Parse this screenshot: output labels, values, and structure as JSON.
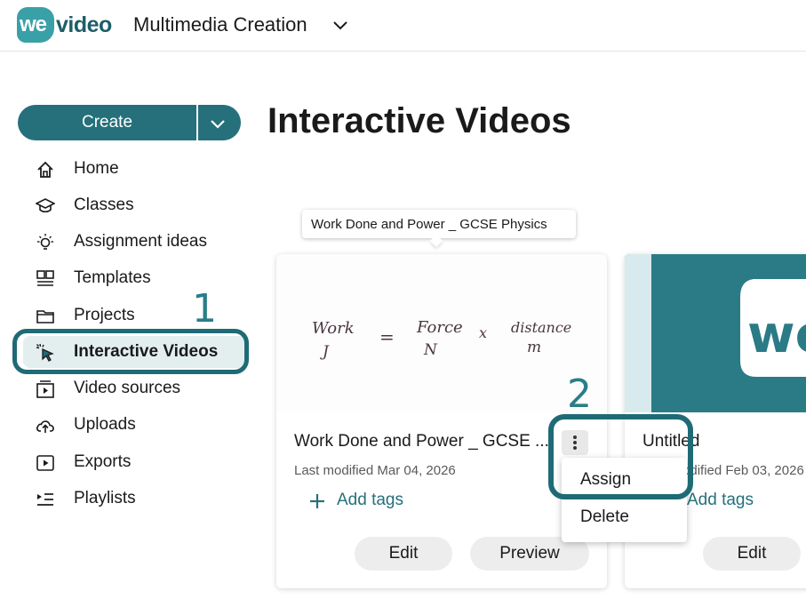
{
  "header": {
    "logo_we": "we",
    "logo_video": "video",
    "workspace_name": "Multimedia Creation"
  },
  "sidebar": {
    "create_label": "Create",
    "items": [
      {
        "label": "Home",
        "icon": "home-icon"
      },
      {
        "label": "Classes",
        "icon": "graduation-cap-icon"
      },
      {
        "label": "Assignment ideas",
        "icon": "lightbulb-icon"
      },
      {
        "label": "Templates",
        "icon": "templates-icon"
      },
      {
        "label": "Projects",
        "icon": "folder-icon"
      },
      {
        "label": "Interactive Videos",
        "icon": "cursor-click-icon",
        "active": true
      },
      {
        "label": "Video sources",
        "icon": "video-source-icon"
      },
      {
        "label": "Uploads",
        "icon": "cloud-upload-icon"
      },
      {
        "label": "Exports",
        "icon": "export-play-icon"
      },
      {
        "label": "Playlists",
        "icon": "playlist-icon"
      }
    ]
  },
  "annotations": {
    "step1": "1",
    "step2": "2"
  },
  "main": {
    "title": "Interactive Videos",
    "tooltip": "Work Done and Power _ GCSE Physics",
    "cards": [
      {
        "title": "Work Done and Power _ GCSE ...",
        "date": "Last modified Mar 04, 2026",
        "add_tags": "Add tags",
        "edit": "Edit",
        "preview": "Preview",
        "thumbnail_text": {
          "work": "Work",
          "work_unit": "J",
          "equals": "=",
          "force": "Force",
          "force_unit": "N",
          "times": "x",
          "distance": "distance",
          "distance_unit": "m"
        }
      },
      {
        "title": "Untitled",
        "date": "Last modified Feb 03, 2026",
        "add_tags": "Add tags",
        "edit": "Edit",
        "thumbnail_text": "we"
      }
    ],
    "menu": {
      "assign": "Assign",
      "delete": "Delete"
    }
  },
  "colors": {
    "brand_teal": "#25707b",
    "highlight_ring": "#1f6b75",
    "thumbnail_teal": "#2a7b86"
  }
}
